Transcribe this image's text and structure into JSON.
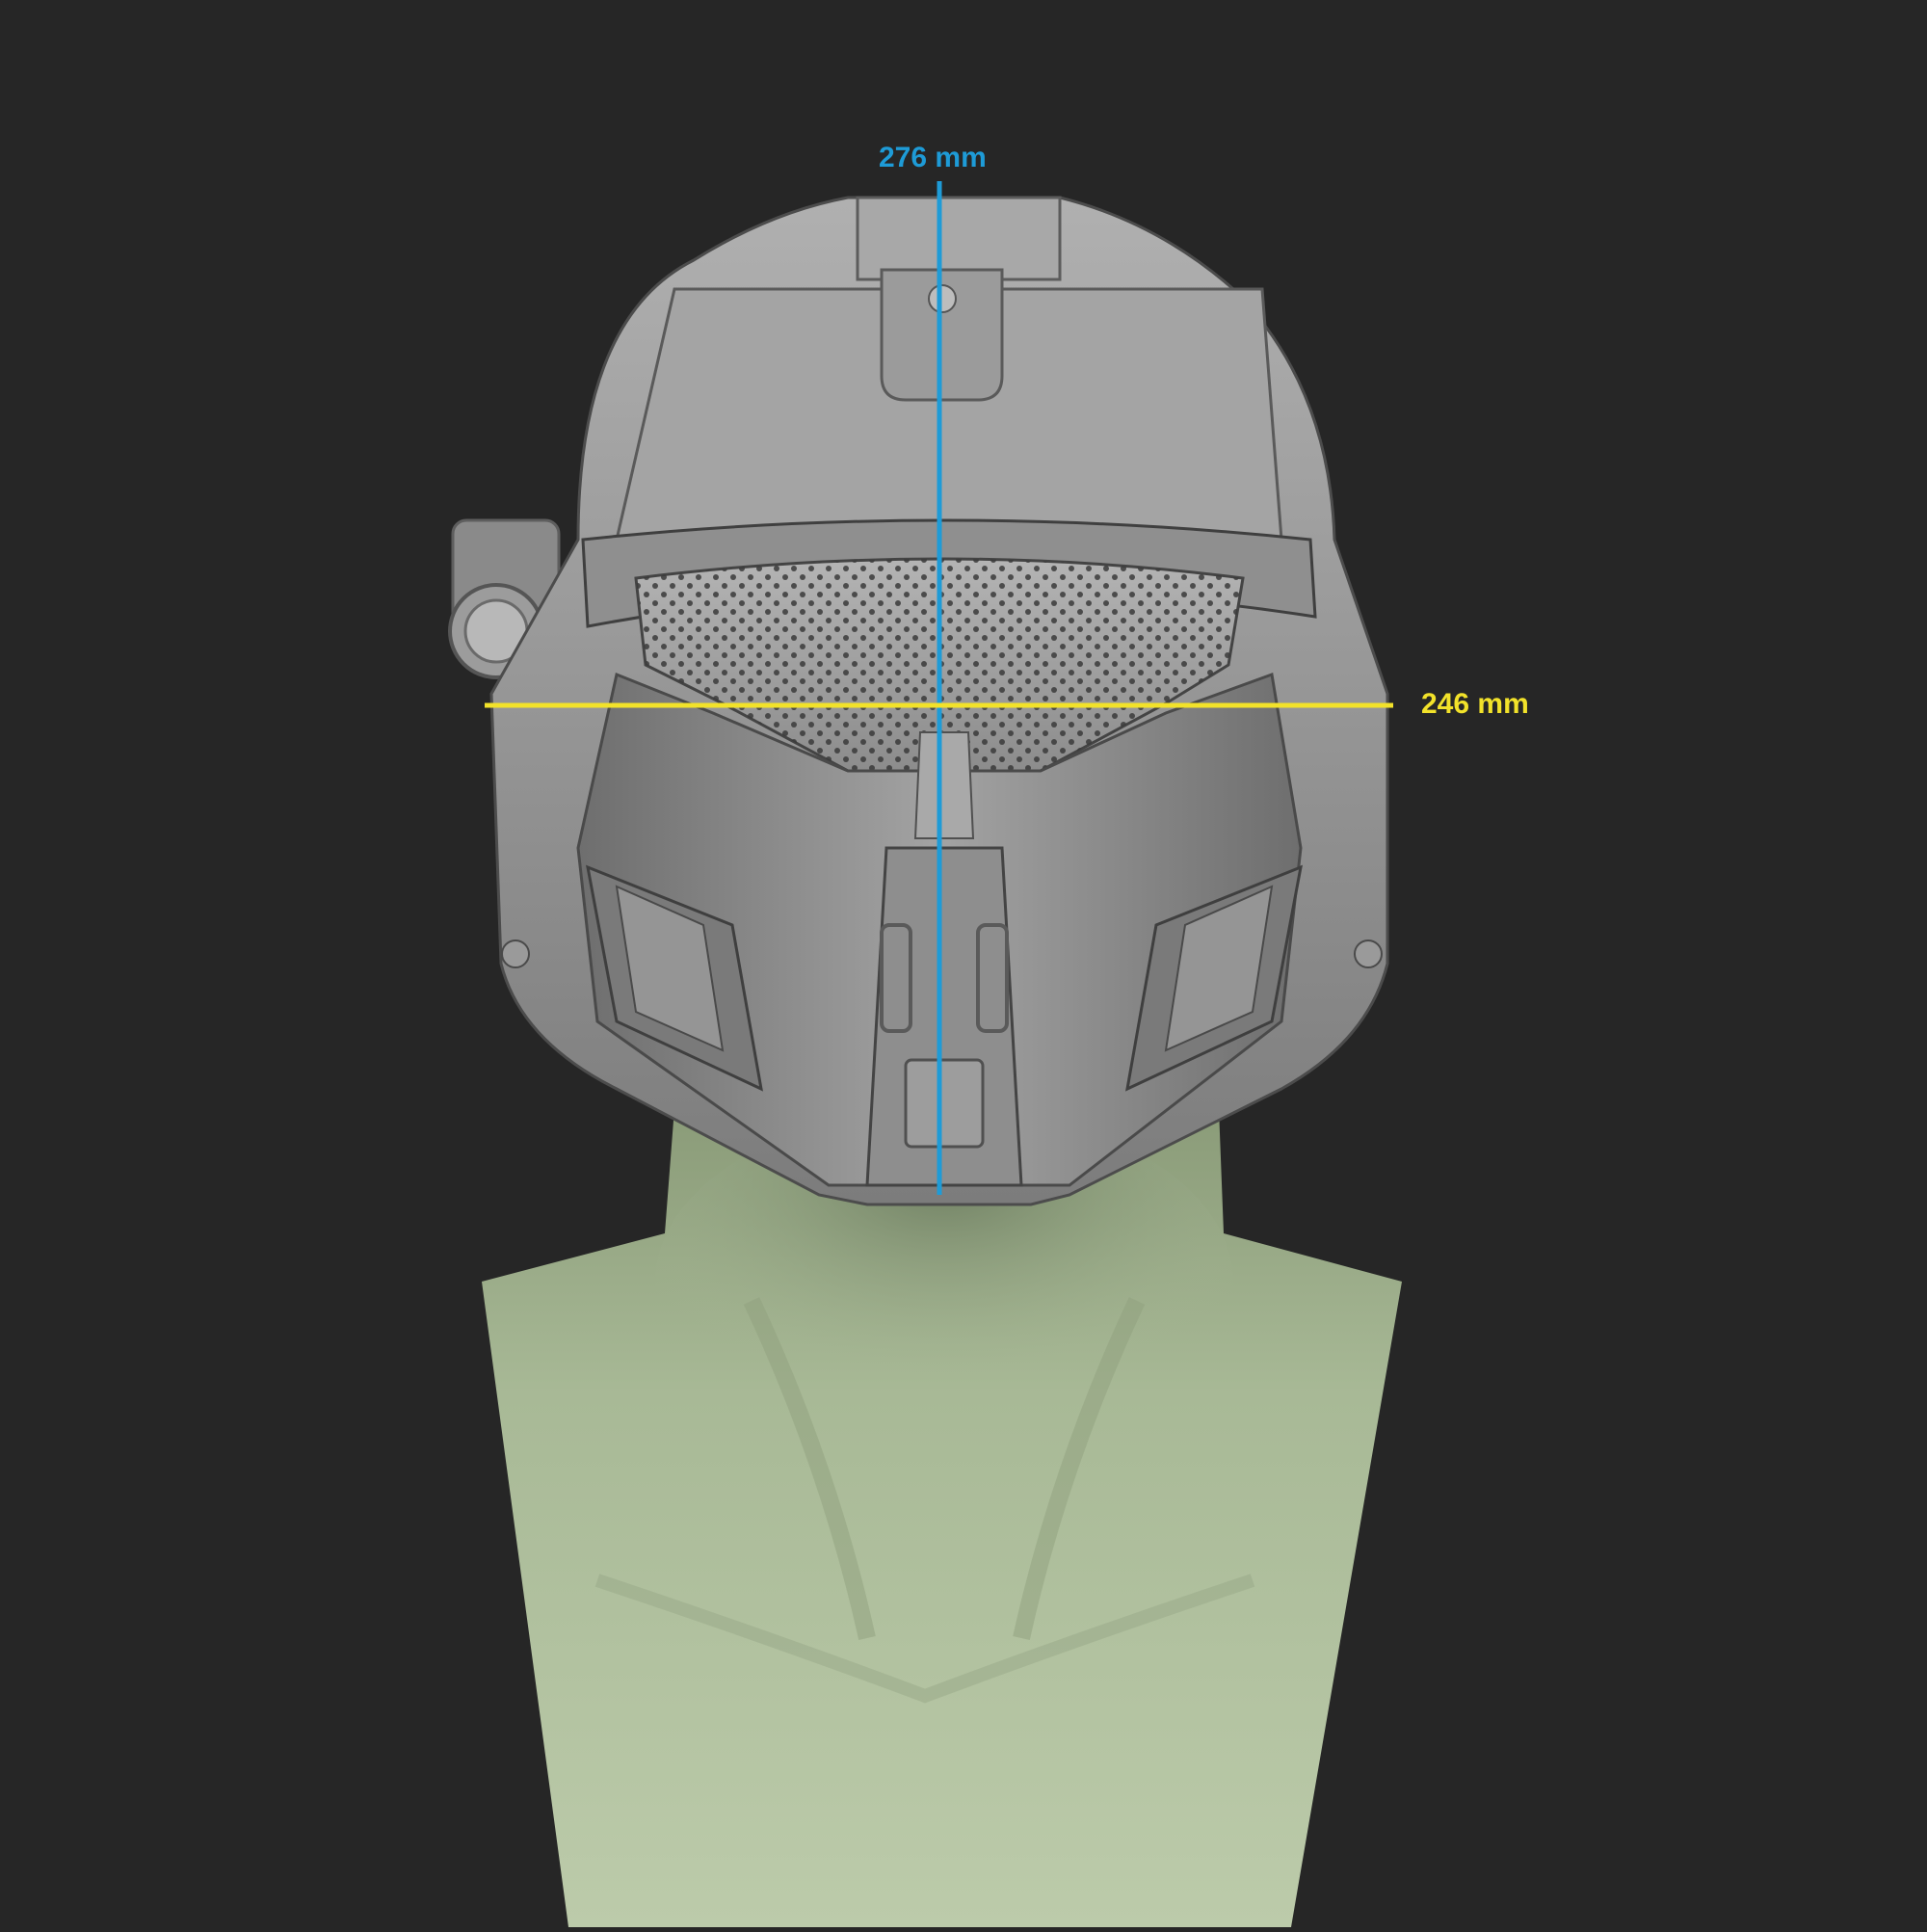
{
  "measurements": {
    "height": {
      "label": "276 mm",
      "color": "#1e9bd7"
    },
    "width": {
      "label": "246 mm",
      "color": "#f2e22a"
    }
  },
  "colors": {
    "background": "#262626",
    "helmet": "#8e8e8e",
    "bust": "#a9bb98"
  },
  "icons": {
    "helmet": "tactical-helmet-icon",
    "bust": "neck-bust-icon",
    "flashlight": "flashlight-icon"
  }
}
